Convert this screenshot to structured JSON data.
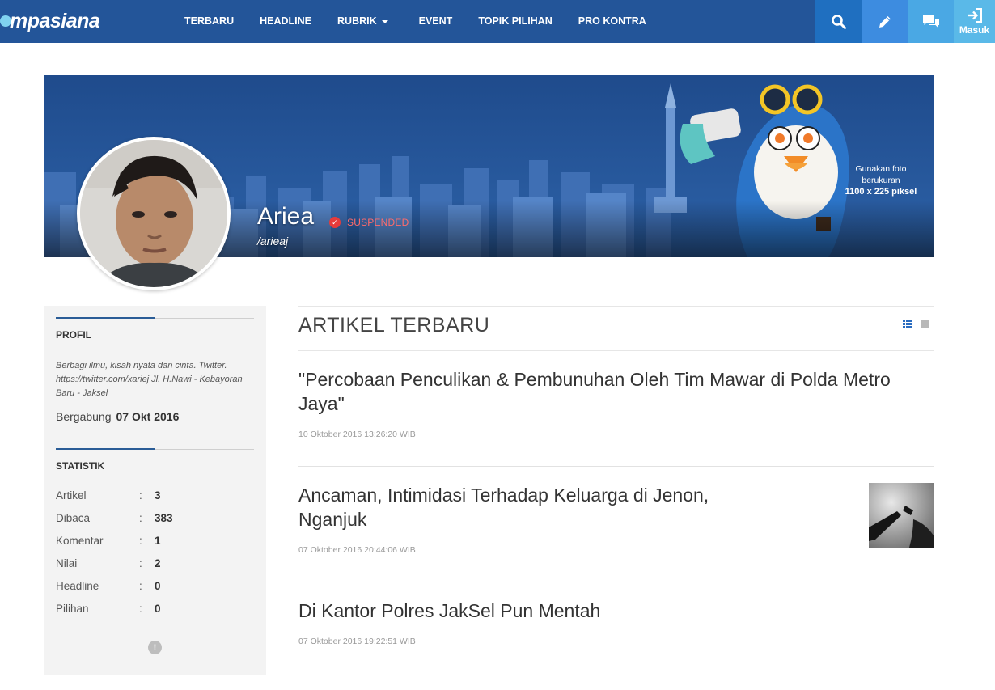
{
  "brand": {
    "logo_text": "mpasiana"
  },
  "nav": {
    "items": [
      "TERBARU",
      "HEADLINE",
      "RUBRIK",
      "EVENT",
      "TOPIK PILIHAN",
      "PRO KONTRA"
    ],
    "login_label": "Masuk"
  },
  "cover": {
    "hint_line1": "Gunakan foto",
    "hint_line2": "berukuran",
    "hint_line3": "1100 x 225 piksel"
  },
  "profile": {
    "name": "Ariea",
    "status": "SUSPENDED",
    "handle": "/arieaj"
  },
  "sidebar": {
    "profil_title": "PROFIL",
    "bio": "Berbagi ilmu, kisah nyata dan cinta. Twitter. https://twitter.com/xariej Jl. H.Nawi - Kebayoran Baru - Jaksel",
    "joined_label": "Bergabung",
    "joined_date": "07 Okt 2016",
    "stats_title": "STATISTIK",
    "stats": [
      {
        "label": "Artikel",
        "sep": ":",
        "value": "3"
      },
      {
        "label": "Dibaca",
        "sep": ":",
        "value": "383"
      },
      {
        "label": "Komentar",
        "sep": ":",
        "value": "1"
      },
      {
        "label": "Nilai",
        "sep": ":",
        "value": "2"
      },
      {
        "label": "Headline",
        "sep": ":",
        "value": "0"
      },
      {
        "label": "Pilihan",
        "sep": ":",
        "value": "0"
      }
    ]
  },
  "main": {
    "heading": "ARTIKEL TERBARU",
    "articles": [
      {
        "title": "\"Percobaan Penculikan & Pembunuhan Oleh Tim Mawar di Polda Metro Jaya\"",
        "date": "10 Oktober 2016 13:26:20 WIB"
      },
      {
        "title": "Ancaman, Intimidasi Terhadap Keluarga di Jenon, Nganjuk",
        "date": "07 Oktober 2016 20:44:06 WIB"
      },
      {
        "title": "Di Kantor Polres JakSel Pun Mentah",
        "date": "07 Oktober 2016 19:22:51 WIB"
      }
    ]
  },
  "colors": {
    "nav_bg": "#235599",
    "accent": "#2a5c96",
    "suspended": "#e63b3b"
  }
}
